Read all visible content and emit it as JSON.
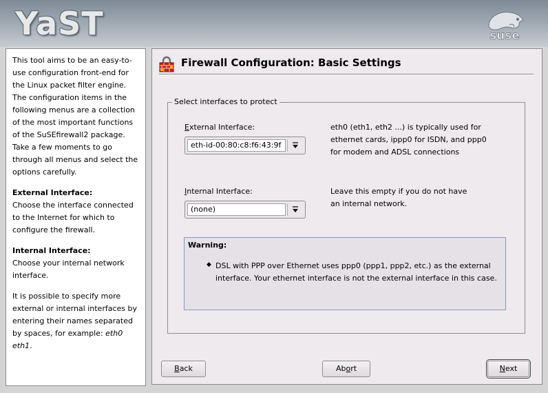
{
  "branding": {
    "app_logo_text": "YaST",
    "vendor_logo_text": "suse"
  },
  "help": {
    "intro": "This tool aims to be an easy-to-use configuration front-end for the Linux packet filter engine. The configuration items in the following menus are a collection of the most important functions of the SuSEfirewall2 package. Take a few moments to go through all menus and select the options carefully.",
    "external_heading": "External Interface:",
    "external_text": "Choose the interface connected to the Internet for which to configure the firewall.",
    "internal_heading": "Internal Interface:",
    "internal_text": "Choose your internal network interface.",
    "spec_text": "It is possible to specify more external or internal interfaces by entering their names separated by spaces, for example: ",
    "spec_example": "eth0 eth1",
    "spec_end": "."
  },
  "main": {
    "title": "Firewall Configuration: Basic Settings",
    "frame_label": "Select interfaces to protect",
    "external": {
      "label_access": "E",
      "label_rest": "xternal Interface:",
      "value": "eth-id-00:80:c8:f6:43:9f",
      "note": "eth0 (eth1, eth2 ...) is typically used for ethernet cards, ippp0 for ISDN, and ppp0 for modem and ADSL connections"
    },
    "internal": {
      "label_access": "I",
      "label_rest": "nternal Interface:",
      "value": "(none)",
      "note": "Leave this empty if you do not have an internal network."
    },
    "warning": {
      "title": "Warning:",
      "text": "DSL with PPP over Ethernet uses ppp0 (ppp1, ppp2, etc.) as the external interface. Your ethernet interface is not the external interface in this case."
    }
  },
  "buttons": {
    "back_access": "B",
    "back_rest": "ack",
    "abort_pre": "Ab",
    "abort_access": "o",
    "abort_rest": "rt",
    "next_access": "N",
    "next_rest": "ext"
  }
}
